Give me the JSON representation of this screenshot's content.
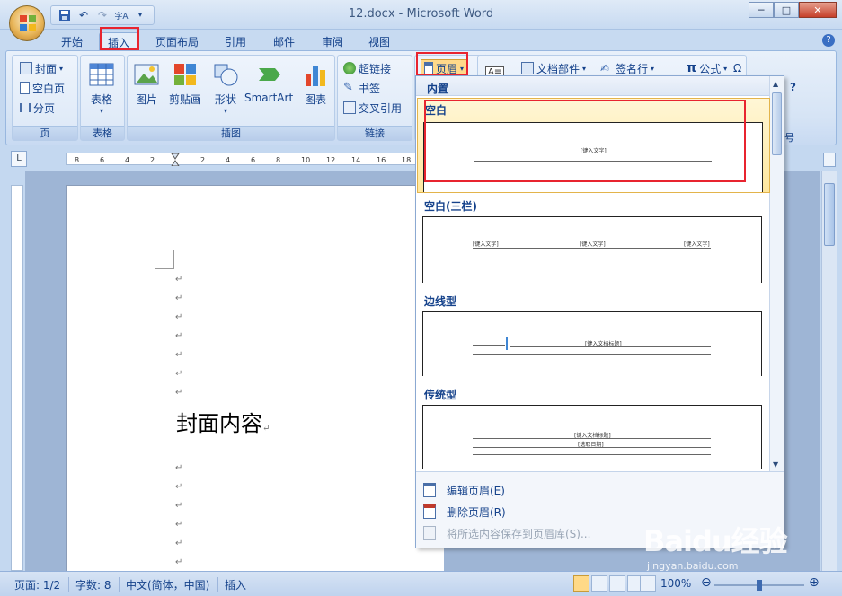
{
  "window": {
    "title": "12.docx - Microsoft Word",
    "minimize": "─",
    "maximize": "□",
    "close": "✕"
  },
  "qat": [
    "save-icon",
    "undo-icon",
    "redo-icon",
    "spellcheck-icon",
    "customize-icon"
  ],
  "tabs": [
    "开始",
    "插入",
    "页面布局",
    "引用",
    "邮件",
    "审阅",
    "视图"
  ],
  "active_tab": "插入",
  "ribbon": {
    "page_group": {
      "label": "页",
      "items": [
        "封面",
        "空白页",
        "分页"
      ]
    },
    "table_group": {
      "label": "表格",
      "items": [
        "表格"
      ]
    },
    "illus_group": {
      "label": "插图",
      "items": [
        "图片",
        "剪贴画",
        "形状",
        "SmartArt",
        "图表"
      ]
    },
    "links_group": {
      "label": "链接",
      "items": [
        "超链接",
        "书签",
        "交叉引用"
      ]
    },
    "header_btn": "页眉",
    "doc_parts": "文档部件",
    "signature": "签名行",
    "formula": "公式",
    "partial_label": "号",
    "q_mark": "?"
  },
  "gallery": {
    "header": "内置",
    "items": [
      {
        "title": "空白",
        "placeholders": [
          "[键入文字]"
        ]
      },
      {
        "title": "空白(三栏)",
        "placeholders": [
          "[键入文字]",
          "[键入文字]",
          "[键入文字]"
        ]
      },
      {
        "title": "边线型",
        "placeholders": [
          "[键入文档标题]"
        ]
      },
      {
        "title": "传统型",
        "placeholders": [
          "[键入文档标题]",
          "[选取日期]"
        ]
      }
    ],
    "menu": [
      {
        "label": "编辑页眉(E)",
        "enabled": true
      },
      {
        "label": "删除页眉(R)",
        "enabled": true
      },
      {
        "label": "将所选内容保存到页眉库(S)...",
        "enabled": false
      }
    ]
  },
  "document": {
    "cover_text": "封面内容",
    "para_mark": "↵"
  },
  "ruler": {
    "marks": [
      "8",
      "6",
      "4",
      "2",
      "2",
      "4",
      "6",
      "8",
      "10",
      "12",
      "14",
      "16",
      "18"
    ],
    "corner": "L"
  },
  "status": {
    "page": "页面: 1/2",
    "words": "字数: 8",
    "lang": "中文(简体，中国)",
    "mode": "插入",
    "zoom": "100%"
  },
  "watermark": {
    "brand": "Baidu经验",
    "url": "jingyan.baidu.com"
  },
  "colors": {
    "highlight": "#e8242f",
    "accent": "#15428b"
  }
}
